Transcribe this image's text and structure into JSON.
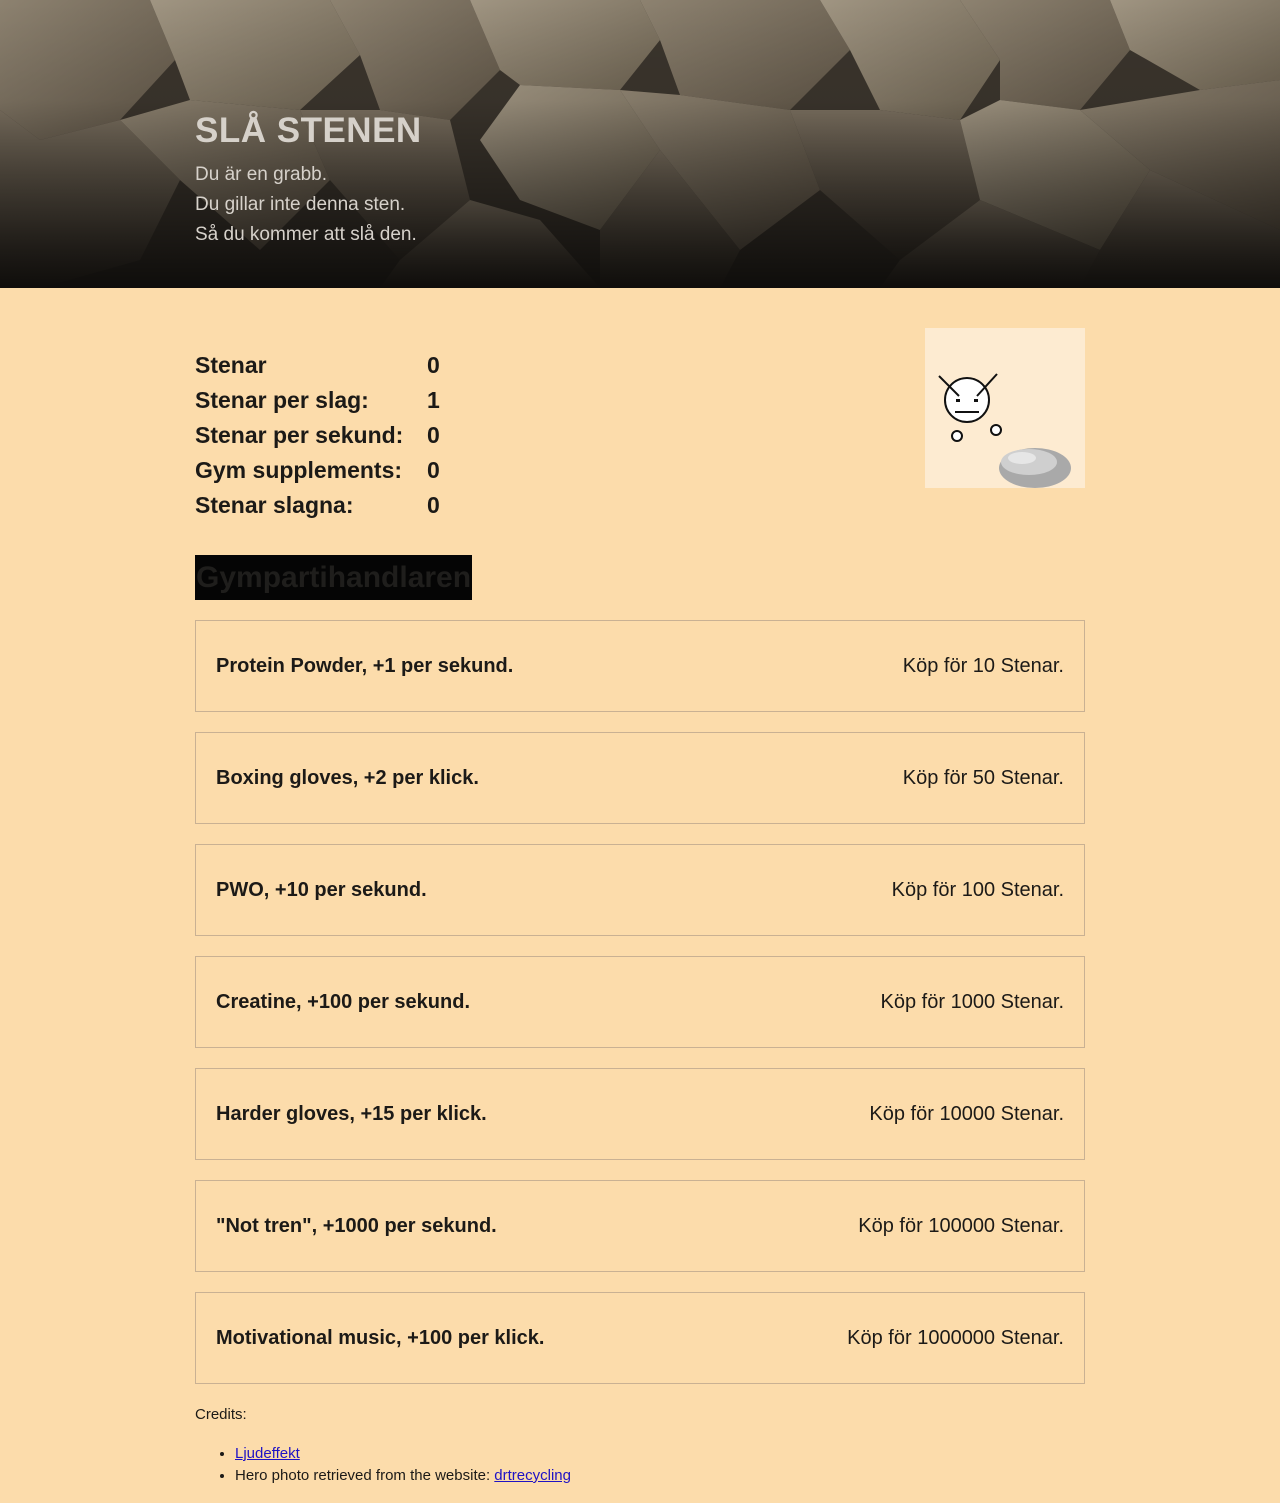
{
  "hero": {
    "title": "SLÅ STENEN",
    "lines": [
      "Du är en grabb.",
      "Du gillar inte denna sten.",
      "Så du kommer att slå den."
    ]
  },
  "stats": [
    {
      "label": "Stenar",
      "value": "0"
    },
    {
      "label": "Stenar per slag:",
      "value": "1"
    },
    {
      "label": "Stenar per sekund:",
      "value": "0"
    },
    {
      "label": "Gym supplements:",
      "value": "0"
    },
    {
      "label": "Stenar slagna:",
      "value": "0"
    }
  ],
  "shop": {
    "title": "Gympartihandlaren",
    "items": [
      {
        "name": "Protein Powder, +1 per sekund.",
        "price": "Köp för 10 Stenar."
      },
      {
        "name": "Boxing gloves, +2 per klick.",
        "price": "Köp för 50 Stenar."
      },
      {
        "name": "PWO, +10 per sekund.",
        "price": "Köp för 100 Stenar."
      },
      {
        "name": "Creatine, +100 per sekund.",
        "price": "Köp för 1000 Stenar."
      },
      {
        "name": "Harder gloves, +15 per klick.",
        "price": "Köp för 10000 Stenar."
      },
      {
        "name": "\"Not tren\", +1000 per sekund.",
        "price": "Köp för 100000 Stenar."
      },
      {
        "name": "Motivational music, +100 per klick.",
        "price": "Köp för 1000000 Stenar."
      }
    ]
  },
  "credits": {
    "title": "Credits:",
    "sound_link": "Ljudeffekt",
    "photo_text": "Hero photo retrieved from the website: ",
    "photo_link": "drtrecycling"
  },
  "colors": {
    "background": "#fcdcab",
    "link": "#1f12c4",
    "shop_title_bg": "#050505"
  }
}
